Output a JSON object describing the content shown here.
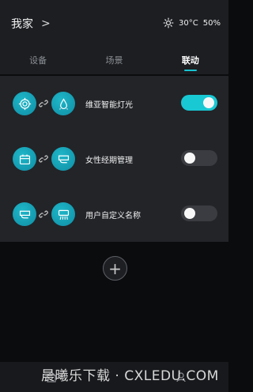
{
  "header": {
    "home_label": "我家",
    "chevron": ">",
    "weather": {
      "icon": "sun-icon",
      "temperature": "30°C",
      "humidity": "50%"
    }
  },
  "tabs": [
    {
      "label": "设备",
      "active": false
    },
    {
      "label": "场景",
      "active": false
    },
    {
      "label": "联动",
      "active": true
    }
  ],
  "linkages": [
    {
      "icon_left": "target-icon",
      "icon_right": "water-drop-icon",
      "label": "维亚智能灯光",
      "enabled": true
    },
    {
      "icon_left": "calendar-icon",
      "icon_right": "air-conditioner-icon",
      "label": "女性经期管理",
      "enabled": false
    },
    {
      "icon_left": "air-conditioner-icon",
      "icon_right": "ac-wind-icon",
      "label": "用户自定义名称",
      "enabled": false
    }
  ],
  "add_button": {
    "icon": "plus-icon",
    "label": "+"
  },
  "watermark": "晨曦乐下载 · CXLEDU.COM",
  "colors": {
    "accent": "#16c3d2",
    "background": "#0b0c0e",
    "panel": "#222428",
    "header": "#1c1e22"
  }
}
